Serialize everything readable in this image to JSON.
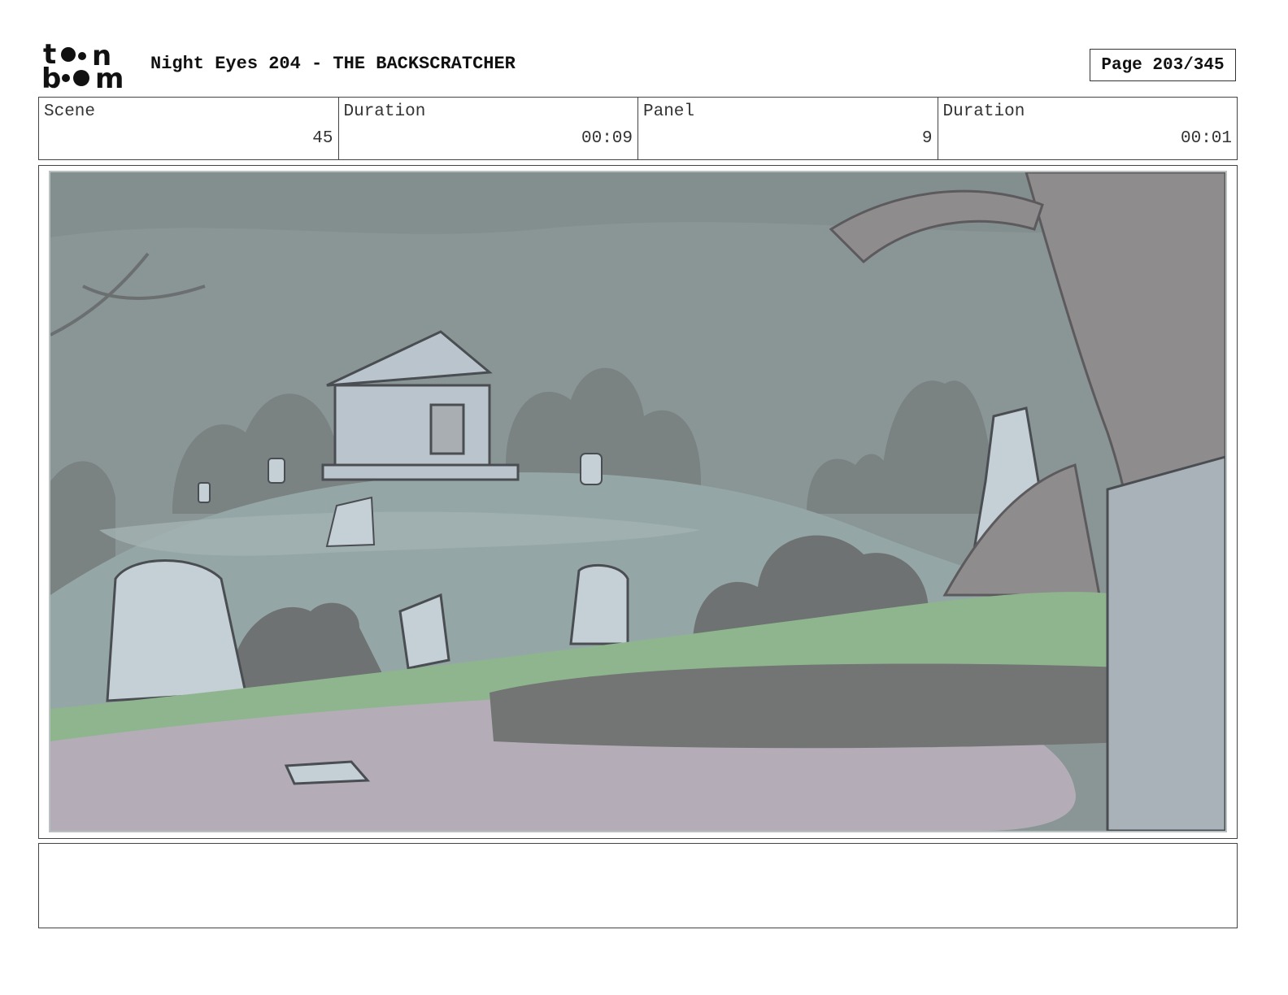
{
  "header": {
    "logo_top": "toon",
    "logo_bottom": "boom",
    "title": "Night Eyes 204 - THE BACKSCRATCHER",
    "page": "Page 203/345"
  },
  "info": [
    {
      "label": "Scene",
      "value": "45"
    },
    {
      "label": "Duration",
      "value": "00:09"
    },
    {
      "label": "Panel",
      "value": "9"
    },
    {
      "label": "Duration",
      "value": "00:01"
    }
  ],
  "notes": {
    "text": ""
  },
  "colors": {
    "sky": "#8a9696",
    "hill": "#95a6a6",
    "grass": "#8fb58f",
    "path": "#b4adb8",
    "shrub": "#6e7272",
    "stone": "#b9c4cc",
    "tree": "#8f8c8e"
  }
}
